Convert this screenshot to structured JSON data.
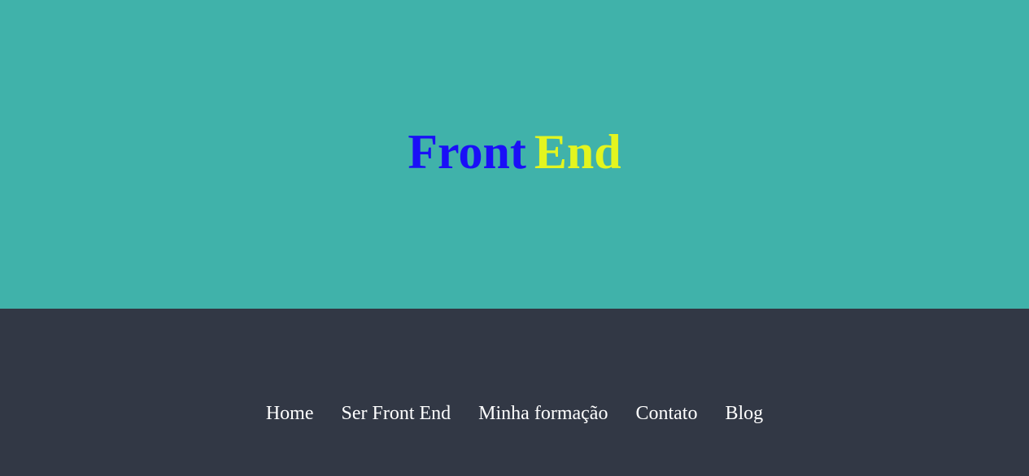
{
  "header": {
    "title_part1": "Front",
    "title_part2": "End",
    "background_color": "#40b2aa",
    "title_part1_color": "#1a0ff7",
    "title_part2_color": "#e3f51f"
  },
  "nav": {
    "background_color": "#323845",
    "items": [
      {
        "label": "Home"
      },
      {
        "label": "Ser Front End"
      },
      {
        "label": "Minha formação"
      },
      {
        "label": "Contato"
      },
      {
        "label": "Blog"
      }
    ]
  }
}
